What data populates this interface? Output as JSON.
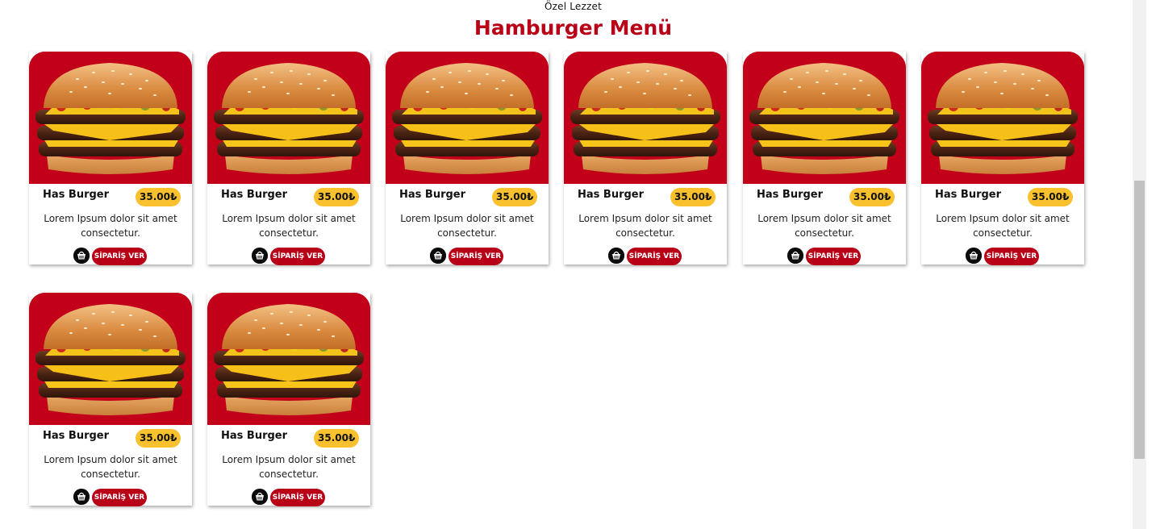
{
  "header": {
    "eyebrow": "Özel Lezzet",
    "title": "Hamburger Menü"
  },
  "colors": {
    "brand_red": "#b80016",
    "price_yellow": "#f9c12d"
  },
  "menu": {
    "items": [
      {
        "name": "Has Burger",
        "price": "35.00₺",
        "description": "Lorem Ipsum dolor sit amet consectetur.",
        "button": "SİPARİŞ VER",
        "image_icon": "burger-image"
      },
      {
        "name": "Has Burger",
        "price": "35.00₺",
        "description": "Lorem Ipsum dolor sit amet consectetur.",
        "button": "SİPARİŞ VER",
        "image_icon": "burger-image"
      },
      {
        "name": "Has Burger",
        "price": "35.00₺",
        "description": "Lorem Ipsum dolor sit amet consectetur.",
        "button": "SİPARİŞ VER",
        "image_icon": "burger-image"
      },
      {
        "name": "Has Burger",
        "price": "35.00₺",
        "description": "Lorem Ipsum dolor sit amet consectetur.",
        "button": "SİPARİŞ VER",
        "image_icon": "burger-image"
      },
      {
        "name": "Has Burger",
        "price": "35.00₺",
        "description": "Lorem Ipsum dolor sit amet consectetur.",
        "button": "SİPARİŞ VER",
        "image_icon": "burger-image"
      },
      {
        "name": "Has Burger",
        "price": "35.00₺",
        "description": "Lorem Ipsum dolor sit amet consectetur.",
        "button": "SİPARİŞ VER",
        "image_icon": "burger-image"
      },
      {
        "name": "Has Burger",
        "price": "35.00₺",
        "description": "Lorem Ipsum dolor sit amet consectetur.",
        "button": "SİPARİŞ VER",
        "image_icon": "burger-image"
      },
      {
        "name": "Has Burger",
        "price": "35.00₺",
        "description": "Lorem Ipsum dolor sit amet consectetur.",
        "button": "SİPARİŞ VER",
        "image_icon": "burger-image"
      }
    ]
  }
}
